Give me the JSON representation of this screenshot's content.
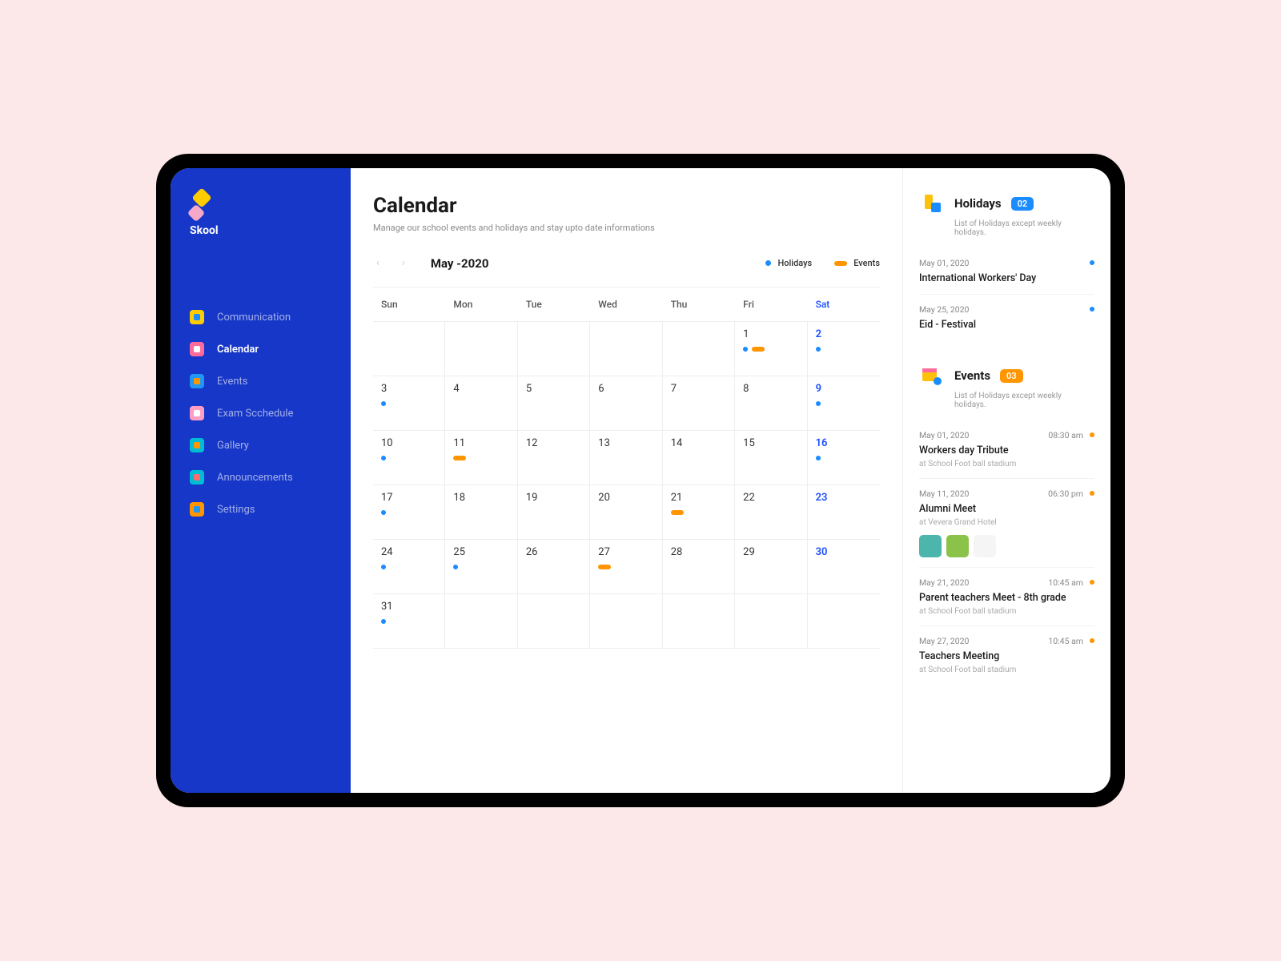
{
  "brand": "Skool",
  "page": {
    "title": "Calendar",
    "subtitle": "Manage our school events and holidays  and stay upto date informations"
  },
  "sidebar": {
    "items": [
      {
        "label": "Communication",
        "icon_bg": "#ffcc00",
        "icon_fg": "#1a8cff"
      },
      {
        "label": "Calendar",
        "icon_bg": "#ff6b9d",
        "icon_fg": "#fff",
        "active": true
      },
      {
        "label": "Events",
        "icon_bg": "#2196f3",
        "icon_fg": "#ff9500"
      },
      {
        "label": "Exam Scchedule",
        "icon_bg": "#ff9ec5",
        "icon_fg": "#fff"
      },
      {
        "label": "Gallery",
        "icon_bg": "#00bcd4",
        "icon_fg": "#ff9500"
      },
      {
        "label": "Announcements",
        "icon_bg": "#00bcd4",
        "icon_fg": "#ff6b6b"
      },
      {
        "label": "Settings",
        "icon_bg": "#ff9500",
        "icon_fg": "#2196f3"
      }
    ]
  },
  "calendar": {
    "month_label": "May -2020",
    "legend": {
      "holidays": "Holidays",
      "events": "Events"
    },
    "dow": [
      "Sun",
      "Mon",
      "Tue",
      "Wed",
      "Thu",
      "Fri",
      "Sat"
    ],
    "cells": [
      {
        "num": ""
      },
      {
        "num": ""
      },
      {
        "num": ""
      },
      {
        "num": ""
      },
      {
        "num": ""
      },
      {
        "num": "1",
        "holiday": true,
        "event": true
      },
      {
        "num": "2",
        "sat": true,
        "holiday": true
      },
      {
        "num": "3",
        "holiday": true
      },
      {
        "num": "4"
      },
      {
        "num": "5"
      },
      {
        "num": "6"
      },
      {
        "num": "7"
      },
      {
        "num": "8"
      },
      {
        "num": "9",
        "sat": true,
        "holiday": true
      },
      {
        "num": "10",
        "holiday": true
      },
      {
        "num": "11",
        "event": true
      },
      {
        "num": "12"
      },
      {
        "num": "13"
      },
      {
        "num": "14"
      },
      {
        "num": "15"
      },
      {
        "num": "16",
        "sat": true,
        "holiday": true
      },
      {
        "num": "17",
        "holiday": true
      },
      {
        "num": "18"
      },
      {
        "num": "19"
      },
      {
        "num": "20"
      },
      {
        "num": "21",
        "event": true
      },
      {
        "num": "22"
      },
      {
        "num": "23",
        "sat": true
      },
      {
        "num": "24",
        "holiday": true
      },
      {
        "num": "25",
        "holiday": true
      },
      {
        "num": "26"
      },
      {
        "num": "27",
        "event": true
      },
      {
        "num": "28"
      },
      {
        "num": "29"
      },
      {
        "num": "30",
        "sat": true
      },
      {
        "num": "31",
        "holiday": true
      },
      {
        "num": ""
      },
      {
        "num": ""
      },
      {
        "num": ""
      },
      {
        "num": ""
      },
      {
        "num": ""
      },
      {
        "num": ""
      }
    ]
  },
  "holidays": {
    "title": "Holidays",
    "count": "02",
    "subtitle": "List of Holidays except weekly holidays.",
    "items": [
      {
        "date": "May 01, 2020",
        "title": "International Workers' Day"
      },
      {
        "date": "May 25, 2020",
        "title": "Eid - Festival"
      }
    ],
    "icon_colors": {
      "a": "#ffc107",
      "b": "#1a8cff"
    }
  },
  "events": {
    "title": "Events",
    "count": "03",
    "subtitle": "List of Holidays except weekly holidays.",
    "items": [
      {
        "date": "May 01, 2020",
        "time": "08:30 am",
        "title": "Workers day Tribute",
        "loc": "at School Foot ball stadium"
      },
      {
        "date": "May 11, 2020",
        "time": "06:30 pm",
        "title": "Alumni Meet",
        "loc": "at Vevera Grand Hotel",
        "thumbs": [
          "#4db6ac",
          "#8bc34a",
          "#f5f5f5"
        ]
      },
      {
        "date": "May 21, 2020",
        "time": "10:45 am",
        "title": "Parent teachers Meet - 8th grade",
        "loc": "at School Foot ball stadium"
      },
      {
        "date": "May 27, 2020",
        "time": "10:45 am",
        "title": "Teachers Meeting",
        "loc": "at School Foot ball stadium"
      }
    ],
    "icon_colors": {
      "a": "#ffc107",
      "b": "#ff6b9d"
    }
  }
}
